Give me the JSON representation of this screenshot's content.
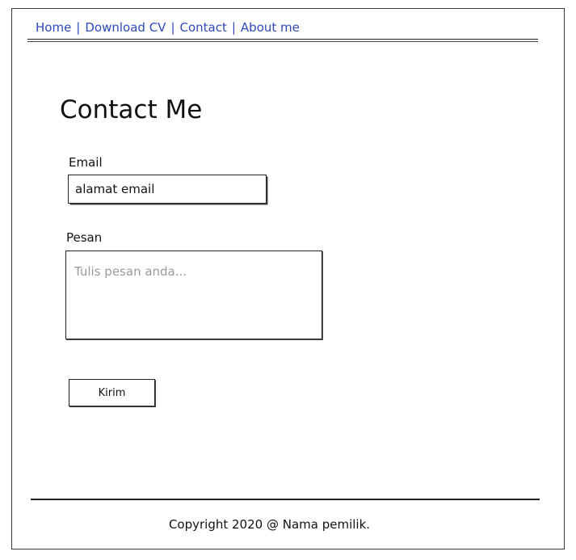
{
  "nav": {
    "items": [
      {
        "label": "Home"
      },
      {
        "label": "Download CV"
      },
      {
        "label": "Contact"
      },
      {
        "label": "About me"
      }
    ],
    "separator": "|",
    "link_color": "#2f49b8"
  },
  "main": {
    "title": "Contact Me",
    "email": {
      "label": "Email",
      "value": "alamat email"
    },
    "message": {
      "label": "Pesan",
      "placeholder": "Tulis pesan anda..."
    },
    "send_label": "Kirim"
  },
  "footer": {
    "text": "Copyright 2020 @ Nama pemilik."
  }
}
